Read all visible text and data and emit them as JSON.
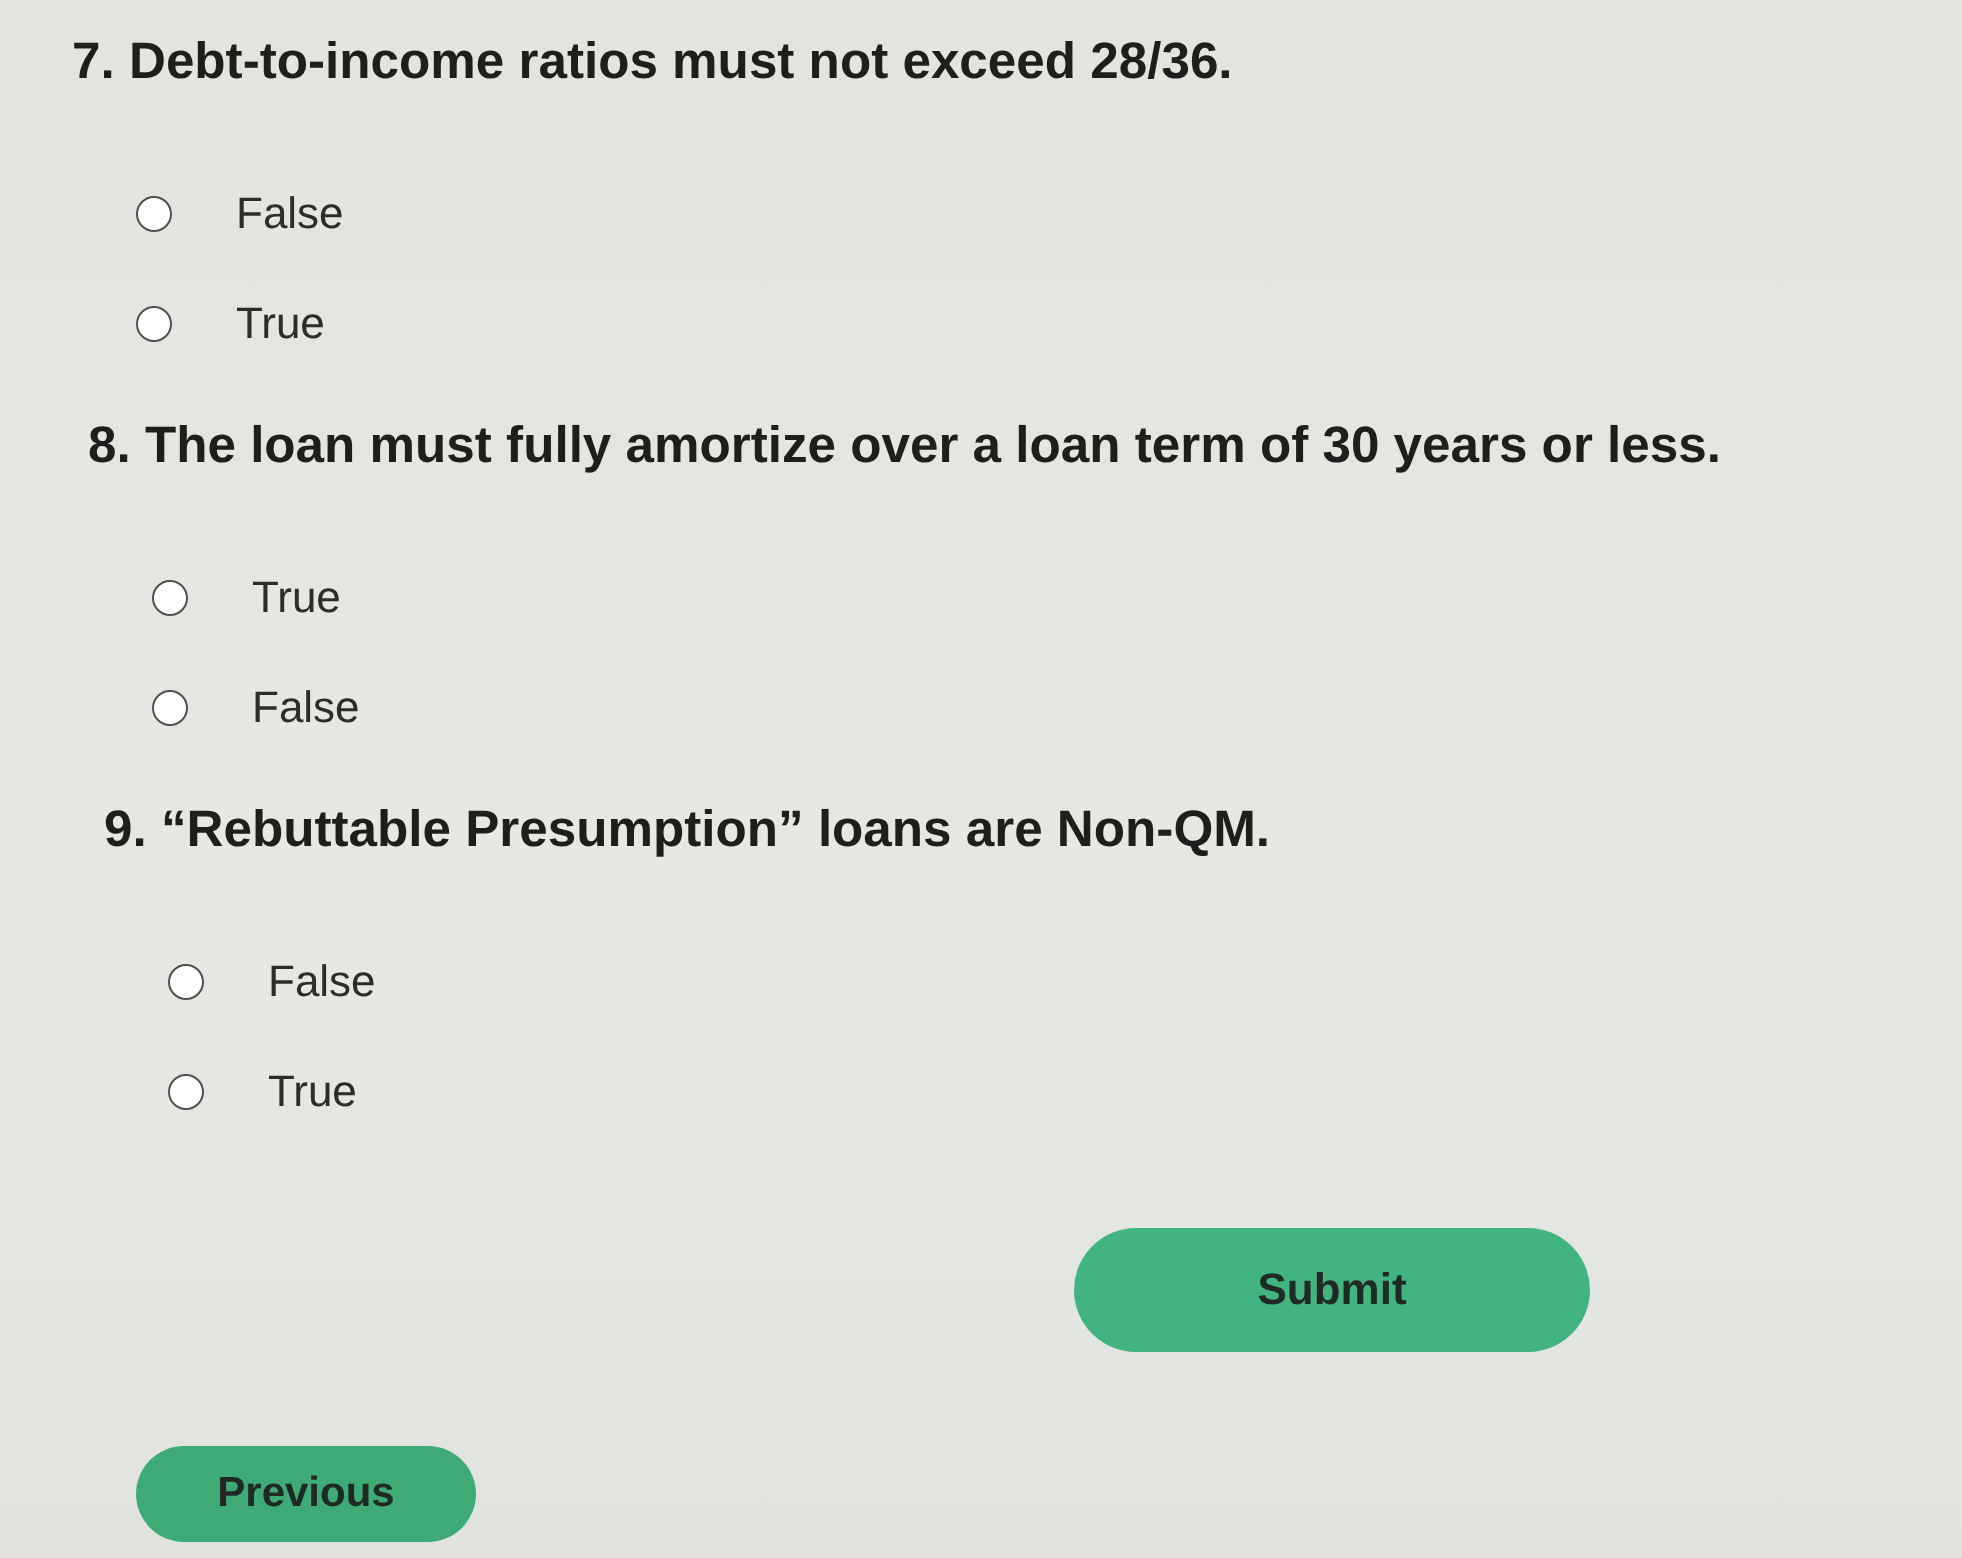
{
  "questions": [
    {
      "title": "7. Debt-to-income ratios must not exceed 28/36.",
      "options": [
        {
          "label": "False",
          "selected": false
        },
        {
          "label": "True",
          "selected": false
        }
      ]
    },
    {
      "title": "8. The loan must fully amortize over a loan term of 30 years or less.",
      "options": [
        {
          "label": "True",
          "selected": false
        },
        {
          "label": "False",
          "selected": false
        }
      ]
    },
    {
      "title": "9. “Rebuttable Presumption” loans are Non-QM.",
      "options": [
        {
          "label": "False",
          "selected": false
        },
        {
          "label": "True",
          "selected": false
        }
      ]
    }
  ],
  "actions": [
    {
      "kind": "submit",
      "label": "Submit"
    },
    {
      "kind": "previous",
      "label": "Previous"
    }
  ]
}
